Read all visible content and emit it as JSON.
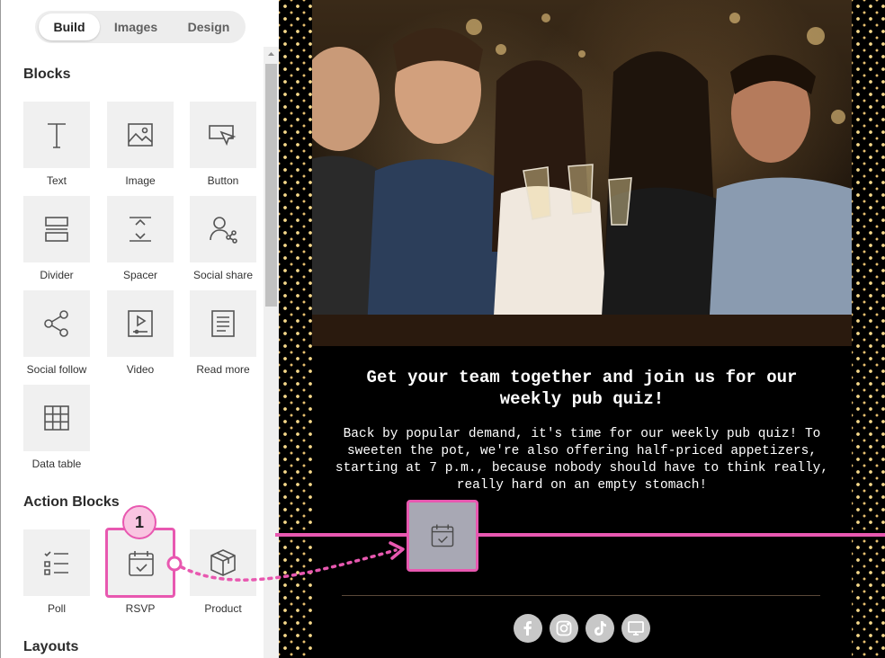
{
  "tabs": [
    {
      "label": "Build",
      "active": true
    },
    {
      "label": "Images",
      "active": false
    },
    {
      "label": "Design",
      "active": false
    }
  ],
  "sections": {
    "blocks": "Blocks",
    "action_blocks": "Action Blocks",
    "layouts": "Layouts"
  },
  "blocks": [
    {
      "label": "Text",
      "icon": "text-icon"
    },
    {
      "label": "Image",
      "icon": "image-icon"
    },
    {
      "label": "Button",
      "icon": "button-icon"
    },
    {
      "label": "Divider",
      "icon": "divider-icon"
    },
    {
      "label": "Spacer",
      "icon": "spacer-icon"
    },
    {
      "label": "Social share",
      "icon": "social-share-icon"
    },
    {
      "label": "Social follow",
      "icon": "social-follow-icon"
    },
    {
      "label": "Video",
      "icon": "video-icon"
    },
    {
      "label": "Read more",
      "icon": "read-more-icon"
    },
    {
      "label": "Data table",
      "icon": "data-table-icon"
    }
  ],
  "action_blocks": [
    {
      "label": "Poll",
      "icon": "poll-icon"
    },
    {
      "label": "RSVP",
      "icon": "rsvp-icon",
      "highlighted": true
    },
    {
      "label": "Product",
      "icon": "product-icon"
    }
  ],
  "step_badge": "1",
  "email": {
    "headline": "Get your team together and join us for our weekly pub quiz!",
    "body": "Back by popular demand, it's time for our weekly pub quiz! To sweeten the pot, we're also offering half-priced appetizers, starting at 7 p.m., because nobody should have to think really, really hard on an empty stomach!",
    "social_icons": [
      "facebook-icon",
      "instagram-icon",
      "tiktok-icon",
      "website-icon"
    ]
  },
  "colors": {
    "accent": "#e858b0",
    "badge_fill": "#f9c5e1",
    "email_bg": "#000000",
    "tile_bg": "#f0f0f0"
  }
}
